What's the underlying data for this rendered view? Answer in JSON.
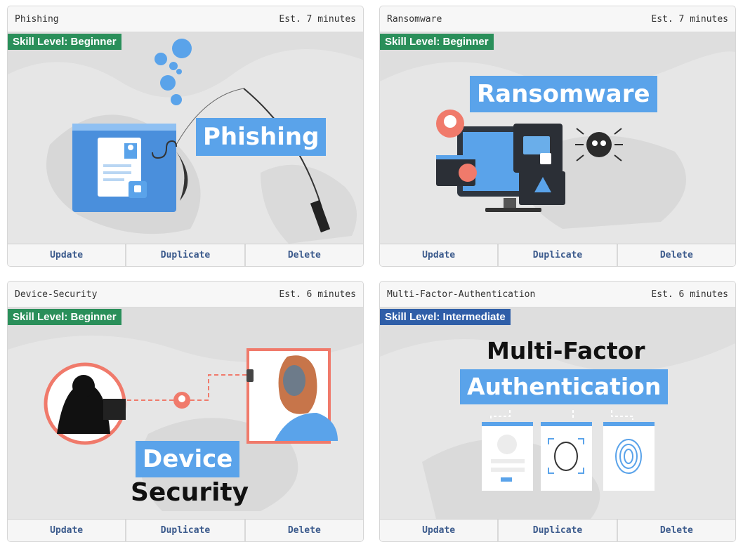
{
  "colors": {
    "beginner": "#2a8f5a",
    "intermediate": "#2f5ea8",
    "accent": "#5aa3ea",
    "button_text": "#3b5a8c"
  },
  "cards": [
    {
      "name": "Phishing",
      "estimate": "Est. 7 minutes",
      "skill": "Skill Level: Beginner",
      "art_title": "Phishing",
      "actions": {
        "update": "Update",
        "duplicate": "Duplicate",
        "delete": "Delete"
      }
    },
    {
      "name": "Ransomware",
      "estimate": "Est. 7 minutes",
      "skill": "Skill Level: Beginner",
      "art_title": "Ransomware",
      "actions": {
        "update": "Update",
        "duplicate": "Duplicate",
        "delete": "Delete"
      }
    },
    {
      "name": "Device-Security",
      "estimate": "Est. 6 minutes",
      "skill": "Skill Level: Beginner",
      "art_title_1": "Device",
      "art_title_2": "Security",
      "actions": {
        "update": "Update",
        "duplicate": "Duplicate",
        "delete": "Delete"
      }
    },
    {
      "name": "Multi-Factor-Authentication",
      "estimate": "Est. 6 minutes",
      "skill": "Skill Level: Intermediate",
      "art_title_1": "Multi-Factor",
      "art_title_2": "Authentication",
      "actions": {
        "update": "Update",
        "duplicate": "Duplicate",
        "delete": "Delete"
      }
    }
  ]
}
